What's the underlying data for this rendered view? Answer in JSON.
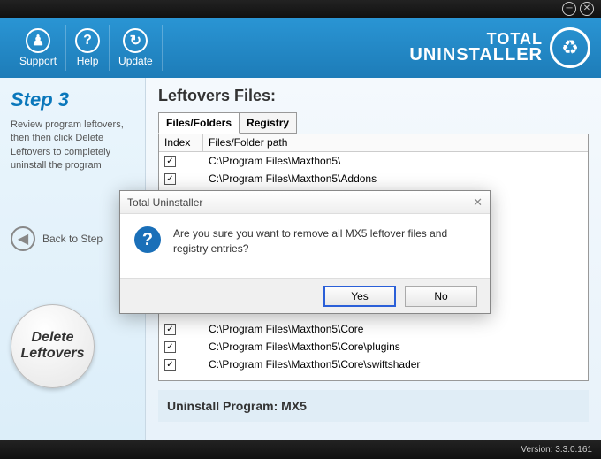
{
  "header": {
    "support": "Support",
    "help": "Help",
    "update": "Update",
    "brand1": "TOTAL",
    "brand2": "UNINSTALLER"
  },
  "sidebar": {
    "step_title": "Step 3",
    "step_desc": "Review program leftovers, then then click Delete Leftovers to completely uninstall the program",
    "back_label": "Back to Step",
    "delete_line1": "Delete",
    "delete_line2": "Leftovers"
  },
  "main": {
    "title": "Leftovers Files:",
    "tabs": [
      "Files/Folders",
      "Registry"
    ],
    "col_index": "Index",
    "col_path": "Files/Folder path",
    "rows": [
      {
        "checked": true,
        "path": "C:\\Program Files\\Maxthon5\\"
      },
      {
        "checked": true,
        "path": "C:\\Program Files\\Maxthon5\\Addons"
      },
      {
        "checked": true,
        "path": "C:\\Program Files\\Maxthon5\\Core"
      },
      {
        "checked": true,
        "path": "C:\\Program Files\\Maxthon5\\Core\\plugins"
      },
      {
        "checked": true,
        "path": "C:\\Program Files\\Maxthon5\\Core\\swiftshader"
      }
    ],
    "uninstall_prefix": "Uninstall Program: ",
    "uninstall_name": "MX5"
  },
  "modal": {
    "title": "Total Uninstaller",
    "message": "Are you sure you want to remove all MX5 leftover files and registry entries?",
    "yes": "Yes",
    "no": "No"
  },
  "footer": {
    "version": "Version: 3.3.0.161"
  }
}
